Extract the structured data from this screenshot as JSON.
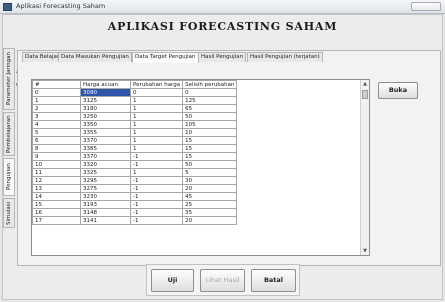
{
  "window": {
    "title": "Aplikasi Forecasting Saham"
  },
  "app": {
    "title": "APLIKASI FORECASTING SAHAM"
  },
  "side_tabs": [
    "Parameter Jaringan Saraf",
    "Pembelajaran",
    "Pengujian",
    "Simulasi"
  ],
  "tabs": [
    "Data Belajar",
    "Data Masukan Pengujian",
    "Data Target Pengujian",
    "Hasil Pengujian",
    "Hasil Pengujian (terjatan)"
  ],
  "active_tab": "Data Target Pengujian",
  "table": {
    "columns": [
      "#",
      "Harga acuan",
      "Perubahan harga",
      "Selisih perubahan"
    ],
    "rows": [
      [
        "0",
        "3090",
        "0",
        "0"
      ],
      [
        "1",
        "3125",
        "1",
        "125"
      ],
      [
        "2",
        "3180",
        "1",
        "65"
      ],
      [
        "3",
        "3250",
        "1",
        "50"
      ],
      [
        "4",
        "3350",
        "1",
        "105"
      ],
      [
        "5",
        "3355",
        "1",
        "10"
      ],
      [
        "6",
        "3370",
        "1",
        "15"
      ],
      [
        "8",
        "3385",
        "1",
        "15"
      ],
      [
        "9",
        "3370",
        "-1",
        "15"
      ],
      [
        "10",
        "3320",
        "-1",
        "50"
      ],
      [
        "11",
        "3325",
        "1",
        "5"
      ],
      [
        "12",
        "3295",
        "-1",
        "30"
      ],
      [
        "13",
        "3275",
        "-1",
        "20"
      ],
      [
        "14",
        "3230",
        "-1",
        "45"
      ],
      [
        "15",
        "3193",
        "-1",
        "25"
      ],
      [
        "16",
        "3148",
        "-1",
        "35"
      ],
      [
        "17",
        "3141",
        "-1",
        "20"
      ]
    ]
  },
  "buttons": {
    "buka": "Buka",
    "uji": "Uji",
    "lihat_hasil": "Lihat Hasil",
    "batal": "Batal"
  }
}
